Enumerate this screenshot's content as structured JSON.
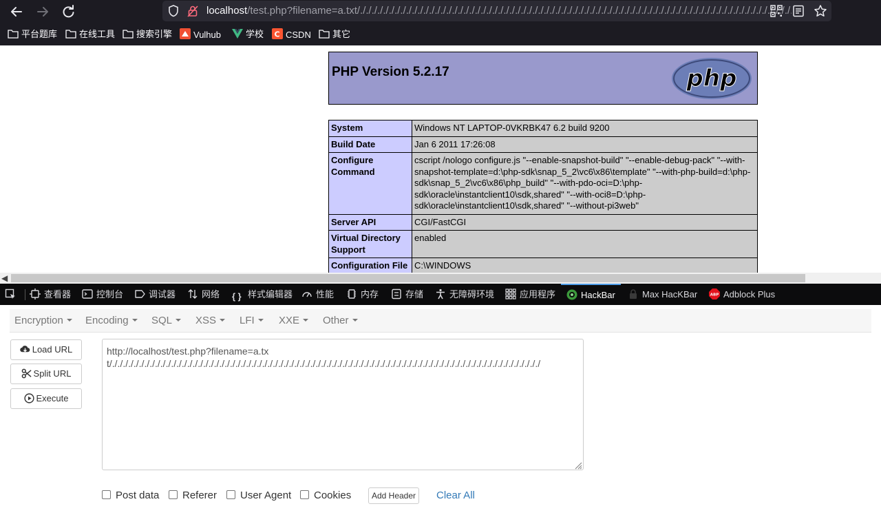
{
  "browser": {
    "url_host": "localhost",
    "url_path": "/test.php?filename=a.txt/././././././././././././././././././././././././././././././././././././././././././././././././././././././././././././././././././././././././././././././././"
  },
  "bookmarks": [
    {
      "label": "平台题库",
      "icon": "folder-icon"
    },
    {
      "label": "在线工具",
      "icon": "folder-icon"
    },
    {
      "label": "搜索引擎",
      "icon": "folder-icon"
    },
    {
      "label": "Vulhub",
      "icon": "vulhub-icon"
    },
    {
      "label": "学校",
      "icon": "vue-icon"
    },
    {
      "label": "CSDN",
      "icon": "csdn-icon"
    },
    {
      "label": "其它",
      "icon": "folder-icon"
    }
  ],
  "phpinfo": {
    "version": "PHP Version 5.2.17",
    "rows": [
      {
        "key": "System",
        "value": "Windows NT LAPTOP-0VKRBK47 6.2 build 9200"
      },
      {
        "key": "Build Date",
        "value": "Jan 6 2011 17:26:08"
      },
      {
        "key": "Configure Command",
        "value": "cscript /nologo configure.js \"--enable-snapshot-build\" \"--enable-debug-pack\" \"--with-snapshot-template=d:\\php-sdk\\snap_5_2\\vc6\\x86\\template\" \"--with-php-build=d:\\php-sdk\\snap_5_2\\vc6\\x86\\php_build\" \"--with-pdo-oci=D:\\php-sdk\\oracle\\instantclient10\\sdk,shared\" \"--with-oci8=D:\\php-sdk\\oracle\\instantclient10\\sdk,shared\" \"--without-pi3web\""
      },
      {
        "key": "Server API",
        "value": "CGI/FastCGI"
      },
      {
        "key": "Virtual Directory Support",
        "value": "enabled"
      },
      {
        "key": "Configuration File",
        "value": "C:\\WINDOWS"
      }
    ]
  },
  "devtools": {
    "tabs": [
      {
        "label": "查看器",
        "icon": "inspector-icon"
      },
      {
        "label": "控制台",
        "icon": "console-icon"
      },
      {
        "label": "调试器",
        "icon": "debugger-icon"
      },
      {
        "label": "网络",
        "icon": "network-icon"
      },
      {
        "label": "样式编辑器",
        "icon": "style-editor-icon"
      },
      {
        "label": "性能",
        "icon": "performance-icon"
      },
      {
        "label": "内存",
        "icon": "memory-icon"
      },
      {
        "label": "存储",
        "icon": "storage-icon"
      },
      {
        "label": "无障碍环境",
        "icon": "accessibility-icon"
      },
      {
        "label": "应用程序",
        "icon": "application-icon"
      },
      {
        "label": "HackBar",
        "icon": "hackbar-icon"
      },
      {
        "label": "Max HacKBar",
        "icon": "max-hackbar-icon"
      },
      {
        "label": "Adblock Plus",
        "icon": "abp-icon"
      }
    ],
    "active_tab": "HackBar"
  },
  "hackbar": {
    "menu": [
      "Encryption",
      "Encoding",
      "SQL",
      "XSS",
      "LFI",
      "XXE",
      "Other"
    ],
    "buttons": {
      "load": "Load URL",
      "split": "Split URL",
      "execute": "Execute"
    },
    "url_value": "http://localhost/test.php?filename=a.txt/././././././././././././././././././././././././././././././././././././././././././././././././././././././././././././././././././././././././././././././././",
    "options": {
      "post": "Post data",
      "referer": "Referer",
      "user_agent": "User Agent",
      "cookies": "Cookies"
    },
    "add_header": "Add Header",
    "clear_all": "Clear All"
  }
}
